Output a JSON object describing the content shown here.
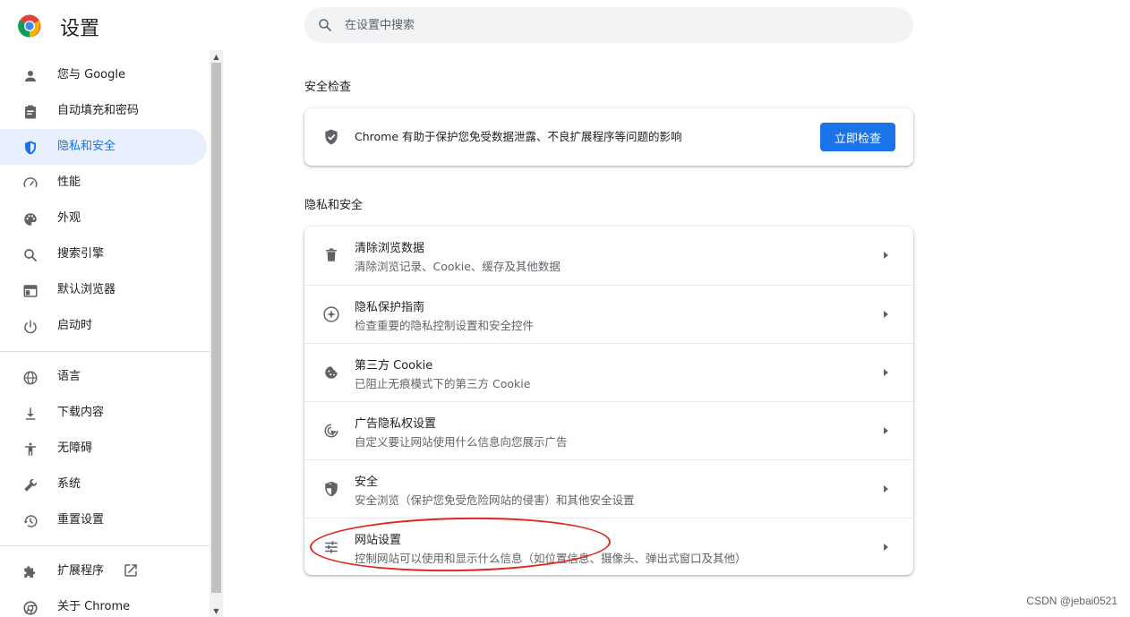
{
  "header": {
    "title": "设置",
    "search_placeholder": "在设置中搜索"
  },
  "sidebar": {
    "items": [
      {
        "label": "您与 Google",
        "icon": "person-icon"
      },
      {
        "label": "自动填充和密码",
        "icon": "clipboard-icon"
      },
      {
        "label": "隐私和安全",
        "icon": "shield-icon",
        "active": true
      },
      {
        "label": "性能",
        "icon": "speedometer-icon"
      },
      {
        "label": "外观",
        "icon": "palette-icon"
      },
      {
        "label": "搜索引擎",
        "icon": "search-icon"
      },
      {
        "label": "默认浏览器",
        "icon": "browser-icon"
      },
      {
        "label": "启动时",
        "icon": "power-icon"
      },
      {
        "label": "语言",
        "icon": "globe-icon"
      },
      {
        "label": "下载内容",
        "icon": "download-icon"
      },
      {
        "label": "无障碍",
        "icon": "accessibility-icon"
      },
      {
        "label": "系统",
        "icon": "wrench-icon"
      },
      {
        "label": "重置设置",
        "icon": "restore-icon"
      },
      {
        "label": "扩展程序",
        "icon": "puzzle-icon"
      },
      {
        "label": "关于 Chrome",
        "icon": "chrome-icon"
      }
    ]
  },
  "safety_check": {
    "title": "安全检查",
    "text": "Chrome 有助于保护您免受数据泄露、不良扩展程序等问题的影响",
    "button_label": "立即检查"
  },
  "privacy": {
    "title": "隐私和安全",
    "rows": [
      {
        "title": "清除浏览数据",
        "subtitle": "清除浏览记录、Cookie、缓存及其他数据",
        "icon": "trash-icon"
      },
      {
        "title": "隐私保护指南",
        "subtitle": "检查重要的隐私控制设置和安全控件",
        "icon": "compass-icon"
      },
      {
        "title": "第三方 Cookie",
        "subtitle": "已阻止无痕模式下的第三方 Cookie",
        "icon": "cookie-icon"
      },
      {
        "title": "广告隐私权设置",
        "subtitle": "自定义要让网站使用什么信息向您展示广告",
        "icon": "ad-privacy-icon"
      },
      {
        "title": "安全",
        "subtitle": "安全浏览（保护您免受危险网站的侵害）和其他安全设置",
        "icon": "security-shield-icon"
      },
      {
        "title": "网站设置",
        "subtitle": "控制网站可以使用和显示什么信息（如位置信息、摄像头、弹出式窗口及其他）",
        "icon": "tune-icon"
      }
    ]
  },
  "watermark": "CSDN @jebai0521",
  "colors": {
    "accent": "#1a73e8",
    "active_bg": "#e8f0fe",
    "annotation": "#e0261f"
  }
}
